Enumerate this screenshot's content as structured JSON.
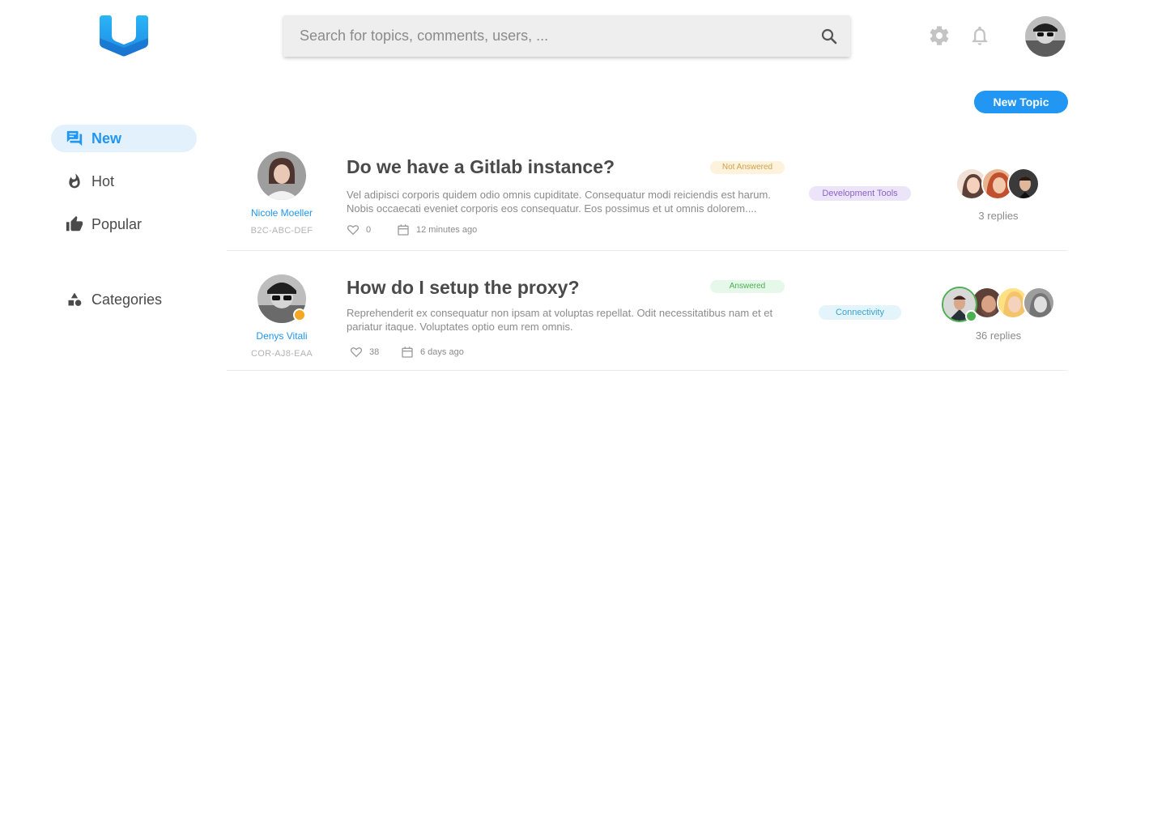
{
  "search": {
    "placeholder": "Search for topics, comments, users, ..."
  },
  "header": {
    "new_topic_label": "New Topic"
  },
  "sidebar": {
    "items": [
      {
        "label": "New",
        "icon": "forum-icon"
      },
      {
        "label": "Hot",
        "icon": "flame-icon"
      },
      {
        "label": "Popular",
        "icon": "thumb-up-icon"
      },
      {
        "label": "Categories",
        "icon": "shapes-icon"
      }
    ]
  },
  "topics": [
    {
      "author": "Nicole Moeller",
      "author_code": "B2C-ABC-DEF",
      "title": "Do we have a Gitlab instance?",
      "excerpt": "Vel adipisci corporis quidem odio omnis cupiditate. Consequatur modi reiciendis est harum. Nobis occaecati eveniet corporis eos consequatur. Eos possimus et ut omnis dolorem....",
      "likes": "0",
      "time": "12 minutes ago",
      "status": "Not Answered",
      "tag": "Development Tools",
      "replies": "3 replies"
    },
    {
      "author": "Denys Vitali",
      "author_code": "COR-AJ8-EAA",
      "title": "How do I setup the proxy?",
      "excerpt": "Reprehenderit ex consequatur non ipsam at voluptas repellat. Odit necessitatibus nam et et pariatur itaque. Voluptates optio eum rem omnis.",
      "likes": "38",
      "time": "6 days ago",
      "status": "Answered",
      "tag": "Connectivity",
      "replies": "36 replies"
    }
  ],
  "colors": {
    "accent": "#2196f3",
    "not_answered_bg": "#fdf3dc",
    "not_answered_text": "#d0a14a",
    "answered_bg": "#e6f8e9",
    "answered_text": "#4caf50",
    "dev_tools_bg": "#ece4f8",
    "dev_tools_text": "#8a63c6",
    "connectivity_bg": "#e3f4fb",
    "connectivity_text": "#3aa3cf"
  }
}
